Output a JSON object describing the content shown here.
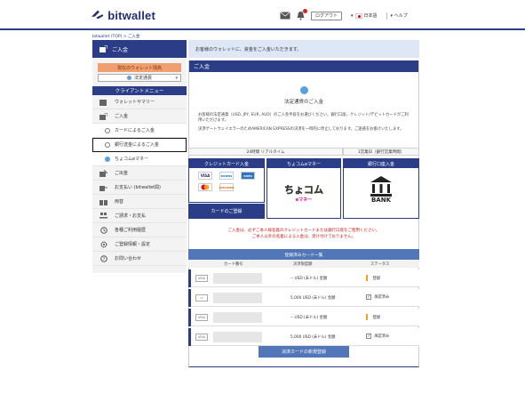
{
  "header": {
    "logo_text": "bitwallet",
    "logout_label": "ログアウト",
    "language": "日本語",
    "help": "ヘルプ"
  },
  "breadcrumb": "bitwallet (TOP) > ご入金",
  "sidebar": {
    "section_title": "ご入金",
    "wallet_select_title": "現在のウォレット残高",
    "wallet_selected": "法定通貨",
    "client_menu": "クライアントメニュー",
    "items": [
      {
        "label": "ウォレットサマリー"
      },
      {
        "label": "ご入金"
      },
      {
        "label": "カードによるご入金"
      },
      {
        "label": "銀行送金によるご入金"
      },
      {
        "label": "ちょコムeマネー"
      },
      {
        "label": "ご出金"
      },
      {
        "label": "お支払い (bitwallet間)"
      },
      {
        "label": "両替"
      },
      {
        "label": "ご請求・お支払"
      },
      {
        "label": "各種ご利用履歴"
      },
      {
        "label": "ご登録情報・設定"
      },
      {
        "label": "お問い合わせ"
      }
    ]
  },
  "notice": "お客様のウォレットに、資金をご入金いただきます。",
  "main": {
    "title": "ご入金",
    "info_title": "法定通貨のご入金",
    "info_text1": "お客様の法定通貨（USD, JPY, EUR, AUD）のご入金手段をお選びください。銀行口座、クレジット/デビットカードがご利用いただけます。",
    "info_text2": "決済ゲートウェイエラーのためAMERICAN EXPRESSの決済を一時的に停止しております。ご迷惑をお掛けいたします。",
    "timing_24h": "24時間 リアルタイム",
    "timing_bank": "1営業日（銀行営業時間）",
    "method_card": "クレジットカード入金",
    "method_chocom": "ちょコムeマネー",
    "method_bank": "銀行口座入金",
    "card_register": "カードのご登録",
    "red_note_1": "ご入金は、必ずご本人様名義のクレジットカードまたは銀行口座をご使用ください。",
    "red_note_2": "ご本人以外の名義による入金は、受け付けておりません。",
    "chocom_logo": "ちょコム",
    "chocom_sub": "eマネー",
    "bank_logo": "BANK"
  },
  "registered_cards": {
    "title": "登録済みカード一覧",
    "col_card": "カード番号",
    "col_limit": "決済限度額",
    "col_status": "ステータス",
    "rows": [
      {
        "brand": "VISA",
        "limit": "-- USD (未ドル) 金額",
        "status": "登録"
      },
      {
        "brand": "▭",
        "limit": "5,000 USD (未ドル) 金額",
        "status": "承認済み"
      },
      {
        "brand": "VISA",
        "limit": "-- USD (未ドル) 金額",
        "status": "登録"
      },
      {
        "brand": "VISA",
        "limit": "5,000 USD (未ドル) 金額",
        "status": "承認済み"
      }
    ],
    "new_card_button": "決済カードの新規登録"
  },
  "card_brands": [
    "VISA",
    "DINERS",
    "AMEX",
    "MC",
    "DISCOVER"
  ],
  "colors": {
    "primary": "#2b3d87",
    "accent": "#f0a070",
    "notice_bg": "#dde7f6",
    "alert": "#d02020"
  }
}
